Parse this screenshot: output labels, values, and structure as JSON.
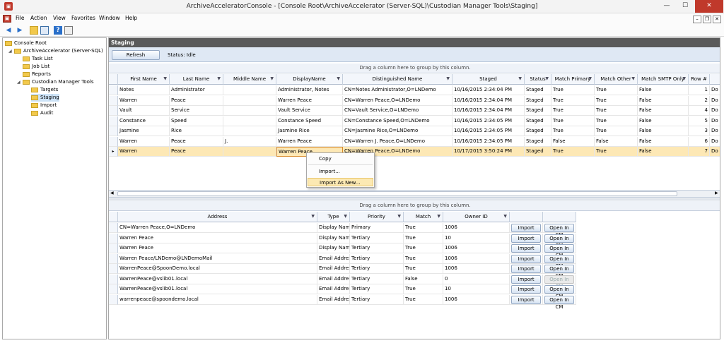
{
  "window": {
    "title": "ArchiveAcceleratorConsole - [Console Root\\ArchiveAccelerator (Server-SQL)\\Custodian Manager Tools\\Staging]",
    "min": "—",
    "max": "☐",
    "close": "✕"
  },
  "menu": [
    "File",
    "Action",
    "View",
    "Favorites",
    "Window",
    "Help"
  ],
  "tree": {
    "root": "Console Root",
    "server": "ArchiveAccelerator (Server-SQL)",
    "items": [
      "Task List",
      "Job List",
      "Reports",
      "Custodian Manager Tools"
    ],
    "cmt_children": [
      "Targets",
      "Staging",
      "Import",
      "Audit"
    ]
  },
  "main": {
    "pane_title": "Staging",
    "refresh_label": "Refresh",
    "status": "Status: Idle",
    "group_hint": "Drag a column here to group by this column.",
    "columns": [
      "First Name",
      "Last Name",
      "Middle Name",
      "DisplayName",
      "Distinguished Name",
      "Staged",
      "Status",
      "Match Primary",
      "Match Other",
      "Match SMTP Only",
      "Row #",
      ""
    ],
    "rows": [
      [
        "Notes",
        "Administrator",
        "",
        "Administrator, Notes",
        "CN=Notes Administrator,O=LNDemo",
        "10/16/2015 2:34:04 PM",
        "Staged",
        "True",
        "True",
        "False",
        "1",
        "Do"
      ],
      [
        "Warren",
        "Peace",
        "",
        "Warren Peace",
        "CN=Warren Peace,O=LNDemo",
        "10/16/2015 2:34:04 PM",
        "Staged",
        "True",
        "True",
        "False",
        "2",
        "Do"
      ],
      [
        "Vault",
        "Service",
        "",
        "Vault Service",
        "CN=Vault Service,O=LNDemo",
        "10/16/2015 2:34:04 PM",
        "Staged",
        "True",
        "True",
        "False",
        "4",
        "Do"
      ],
      [
        "Constance",
        "Speed",
        "",
        "Constance Speed",
        "CN=Constance Speed,O=LNDemo",
        "10/16/2015 2:34:05 PM",
        "Staged",
        "True",
        "True",
        "False",
        "5",
        "Do"
      ],
      [
        "Jasmine",
        "Rice",
        "",
        "Jasmine Rice",
        "CN=Jasmine Rice,O=LNDemo",
        "10/16/2015 2:34:05 PM",
        "Staged",
        "True",
        "True",
        "False",
        "3",
        "Do"
      ],
      [
        "Warren",
        "Peace",
        "J.",
        "Warren Peace",
        "CN=Warren J. Peace,O=LNDemo",
        "10/16/2015 2:34:05 PM",
        "Staged",
        "False",
        "False",
        "False",
        "6",
        "Do"
      ],
      [
        "Warren",
        "Peace",
        "",
        "Warren Peace",
        "CN=Warren Peace,O=LNDemo",
        "10/17/2015 3:50:24 PM",
        "Staged",
        "True",
        "True",
        "False",
        "7",
        "Do"
      ]
    ],
    "context_menu": [
      "Copy",
      "Import...",
      "Import As New..."
    ]
  },
  "detail": {
    "group_hint": "Drag a column here to group by this column.",
    "columns": [
      "Address",
      "Type",
      "Priority",
      "Match",
      "Owner ID"
    ],
    "rows": [
      [
        "CN=Warren Peace,O=LNDemo",
        "Display Name",
        "Primary",
        "True",
        "1006"
      ],
      [
        "Warren Peace",
        "Display Name",
        "Tertiary",
        "True",
        "10"
      ],
      [
        "Warren Peace",
        "Display Name",
        "Tertiary",
        "True",
        "1006"
      ],
      [
        "Warren Peace/LNDemo@LNDemoMail",
        "Email Address",
        "Tertiary",
        "True",
        "1006"
      ],
      [
        "WarrenPeace@SpoonDemo.local",
        "Email Address",
        "Tertiary",
        "True",
        "1006"
      ],
      [
        "WarrenPeace@vslib01.local",
        "Email Address",
        "Tertiary",
        "False",
        "0"
      ],
      [
        "WarrenPeace@vslib01.local",
        "Email Address",
        "Tertiary",
        "True",
        "10"
      ],
      [
        "warrenpeace@spoondemo.local",
        "Email Address",
        "Tertiary",
        "True",
        "1006"
      ]
    ],
    "import_label": "Import",
    "open_label": "Open In CM"
  }
}
